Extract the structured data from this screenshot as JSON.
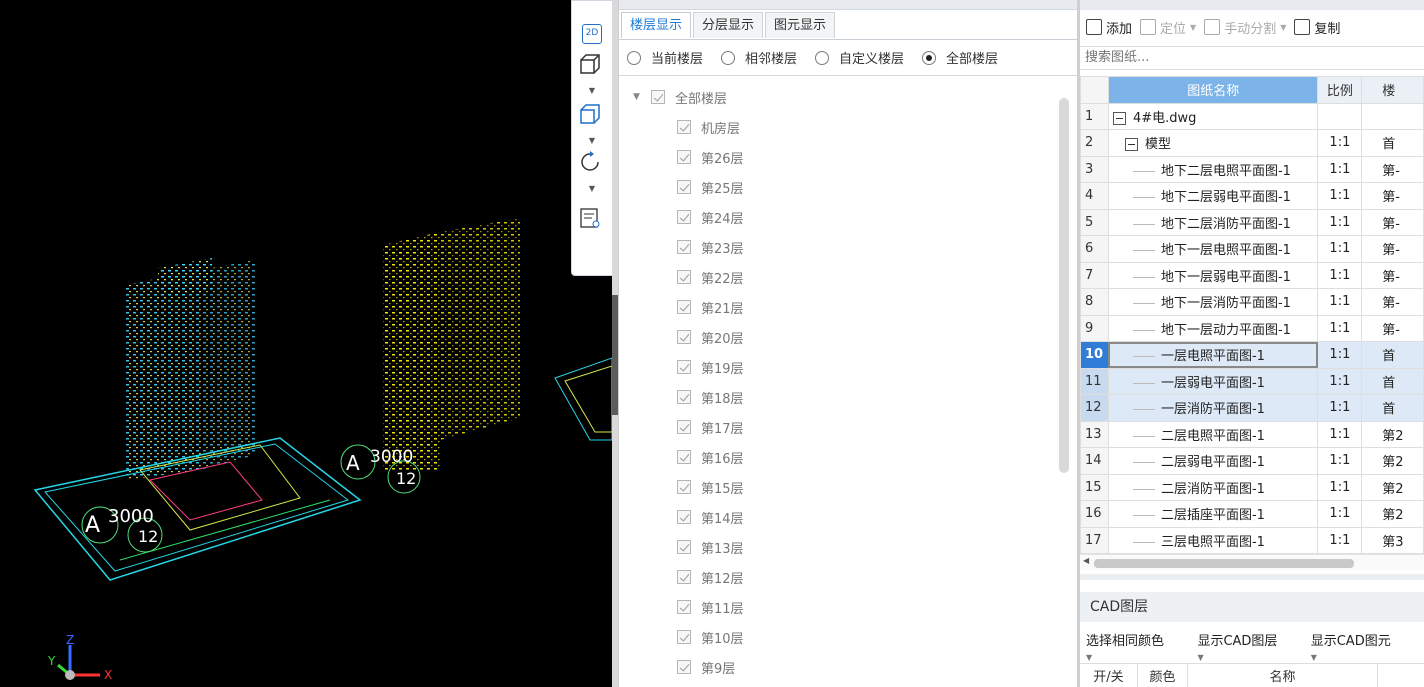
{
  "viewport": {
    "view_2d_label": "2D",
    "axis_labels": {
      "x": "X",
      "y": "Y",
      "z": "Z"
    },
    "markers": [
      {
        "letter": "A",
        "number1": "3000",
        "number2": "12"
      },
      {
        "letter": "A",
        "number1": "3000",
        "number2": "12"
      }
    ]
  },
  "floor_panel": {
    "tabs": [
      {
        "label": "楼层显示",
        "active": true
      },
      {
        "label": "分层显示",
        "active": false
      },
      {
        "label": "图元显示",
        "active": false
      }
    ],
    "radio_options": [
      {
        "label": "当前楼层",
        "checked": false
      },
      {
        "label": "相邻楼层",
        "checked": false
      },
      {
        "label": "自定义楼层",
        "checked": false
      },
      {
        "label": "全部楼层",
        "checked": true
      }
    ],
    "root_label": "全部楼层",
    "floors": [
      "机房层",
      "第26层",
      "第25层",
      "第24层",
      "第23层",
      "第22层",
      "第21层",
      "第20层",
      "第19层",
      "第18层",
      "第17层",
      "第16层",
      "第15层",
      "第14层",
      "第13层",
      "第12层",
      "第11层",
      "第10层",
      "第9层"
    ]
  },
  "drawing_panel": {
    "toolbar": {
      "add": "添加",
      "locate": "定位",
      "split": "手动分割",
      "copy": "复制"
    },
    "search_placeholder": "搜索图纸...",
    "columns": {
      "name": "图纸名称",
      "scale": "比例",
      "floor": "楼"
    },
    "rows": [
      {
        "num": "1",
        "name": "4#电.dwg",
        "scale": "",
        "floor": ""
      },
      {
        "num": "2",
        "name": "模型",
        "scale": "1:1",
        "floor": "首"
      },
      {
        "num": "3",
        "name": "地下二层电照平面图-1",
        "scale": "1:1",
        "floor": "第-"
      },
      {
        "num": "4",
        "name": "地下二层弱电平面图-1",
        "scale": "1:1",
        "floor": "第-"
      },
      {
        "num": "5",
        "name": "地下二层消防平面图-1",
        "scale": "1:1",
        "floor": "第-"
      },
      {
        "num": "6",
        "name": "地下一层电照平面图-1",
        "scale": "1:1",
        "floor": "第-"
      },
      {
        "num": "7",
        "name": "地下一层弱电平面图-1",
        "scale": "1:1",
        "floor": "第-"
      },
      {
        "num": "8",
        "name": "地下一层消防平面图-1",
        "scale": "1:1",
        "floor": "第-"
      },
      {
        "num": "9",
        "name": "地下一层动力平面图-1",
        "scale": "1:1",
        "floor": "第-"
      },
      {
        "num": "10",
        "name": "一层电照平面图-1",
        "scale": "1:1",
        "floor": "首"
      },
      {
        "num": "11",
        "name": "一层弱电平面图-1",
        "scale": "1:1",
        "floor": "首"
      },
      {
        "num": "12",
        "name": "一层消防平面图-1",
        "scale": "1:1",
        "floor": "首"
      },
      {
        "num": "13",
        "name": "二层电照平面图-1",
        "scale": "1:1",
        "floor": "第2"
      },
      {
        "num": "14",
        "name": "二层弱电平面图-1",
        "scale": "1:1",
        "floor": "第2"
      },
      {
        "num": "15",
        "name": "二层消防平面图-1",
        "scale": "1:1",
        "floor": "第2"
      },
      {
        "num": "16",
        "name": "二层插座平面图-1",
        "scale": "1:1",
        "floor": "第2"
      },
      {
        "num": "17",
        "name": "三层电照平面图-1",
        "scale": "1:1",
        "floor": "第3"
      }
    ]
  },
  "cad_layer": {
    "title": "CAD图层",
    "tools": [
      "选择相同颜色",
      "显示CAD图层",
      "显示CAD图元"
    ],
    "columns": [
      "开/关",
      "颜色",
      "名称"
    ]
  }
}
